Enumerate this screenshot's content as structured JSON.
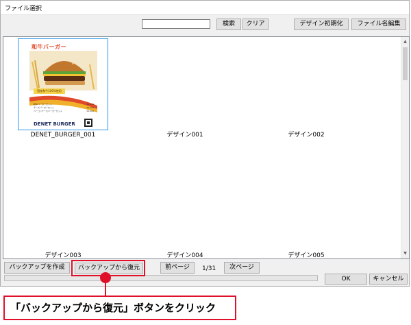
{
  "window": {
    "title": "ファイル選択"
  },
  "toolbar": {
    "search_value": "",
    "search_button": "検索",
    "clear_button": "クリア",
    "reset_design_button": "デザイン初期化",
    "rename_button": "ファイル名編集"
  },
  "thumbnail": {
    "headline": "和牛バーガー",
    "price_banner": "国産和牛100%使用",
    "menu": [
      {
        "item": "和牛バーガーセット",
        "price": "¥1,200"
      },
      {
        "item": "チーズバーガーセット",
        "price": "¥1,000"
      },
      {
        "item": "ベーコンチーズバーガーセット",
        "price": "¥1,100"
      }
    ],
    "brand": "DENET BURGER"
  },
  "grid": {
    "items": [
      {
        "label": "DENET_BURGER_001"
      },
      {
        "label": "デザイン001"
      },
      {
        "label": "デザイン002"
      },
      {
        "label": "デザイン003"
      },
      {
        "label": "デザイン004"
      },
      {
        "label": "デザイン005"
      }
    ]
  },
  "bottom": {
    "backup_create_button": "バックアップを作成",
    "backup_restore_button": "バックアップから復元",
    "prev_button": "前ページ",
    "page_indicator": "1/31",
    "next_button": "次ページ",
    "ok_button": "OK",
    "cancel_button": "キャンセル"
  },
  "annotation": {
    "label": "「バックアップから復元」ボタンをクリック",
    "color": "#e0102a"
  },
  "colors": {
    "selection": "#2b95e6",
    "accent": "#e0102a"
  }
}
